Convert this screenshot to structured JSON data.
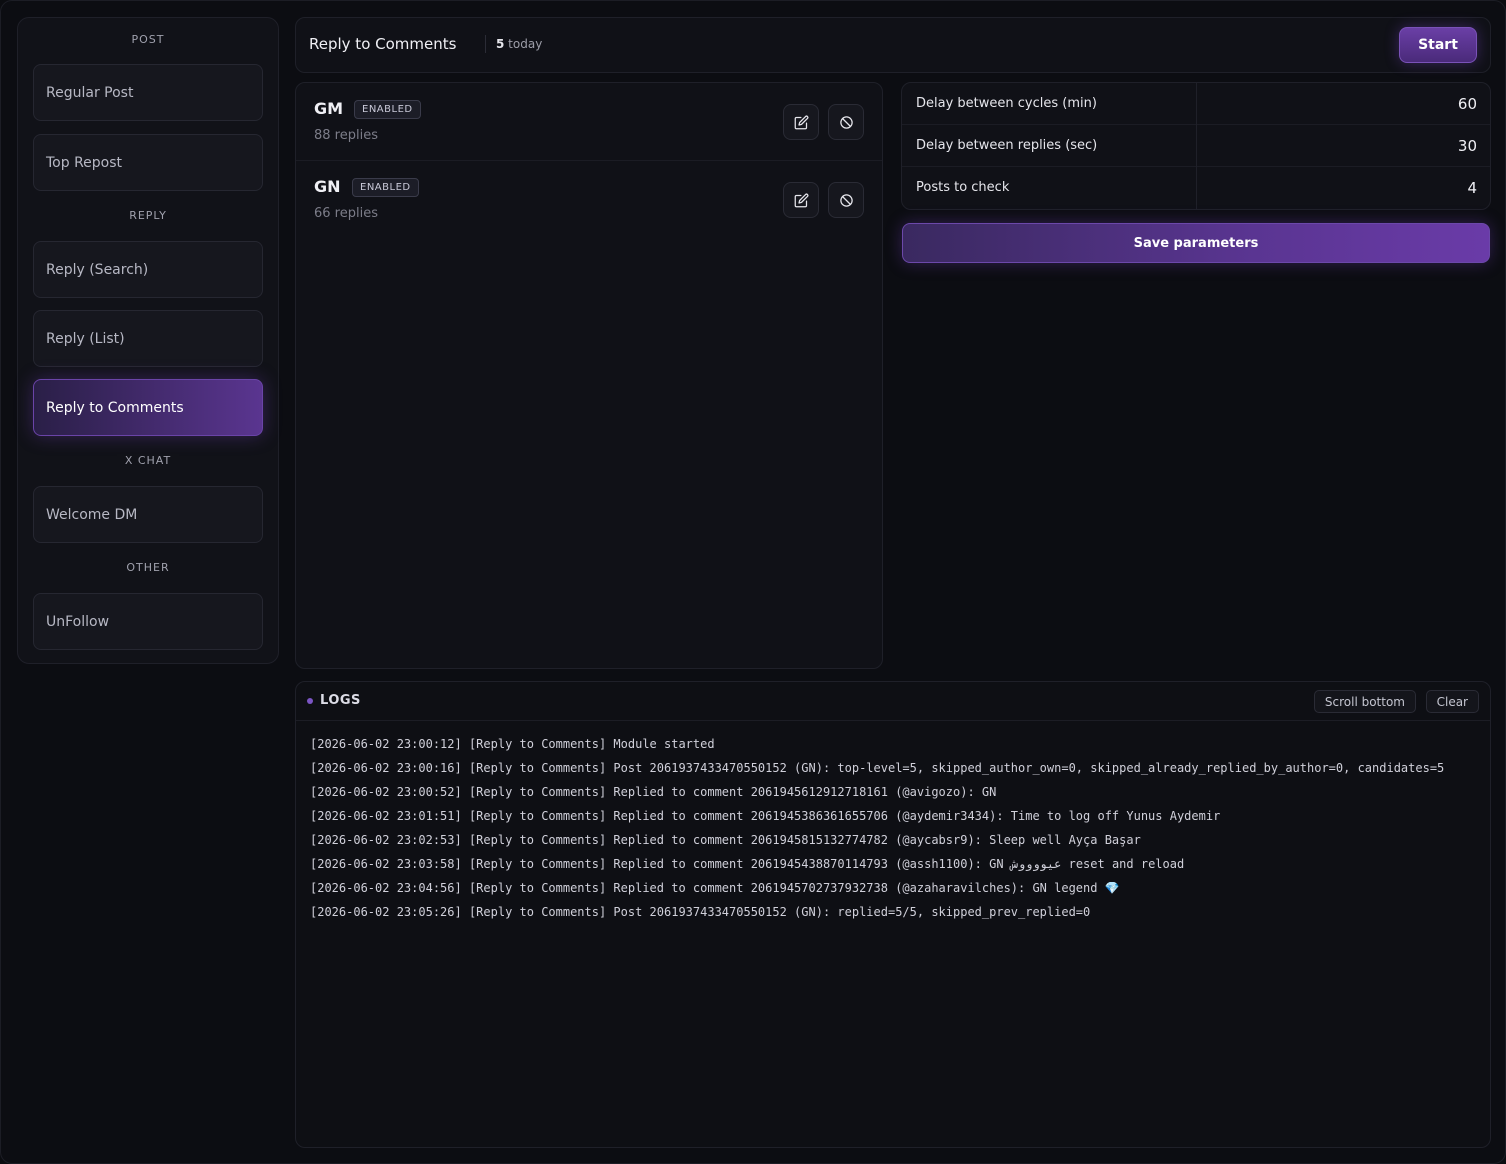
{
  "sidebar": {
    "sections": [
      {
        "label": "POST"
      },
      {
        "label": "REPLY"
      },
      {
        "label": "X CHAT"
      },
      {
        "label": "OTHER"
      }
    ],
    "items": [
      {
        "label": "Regular Post"
      },
      {
        "label": "Top Repost"
      },
      {
        "label": "Reply (Search)"
      },
      {
        "label": "Reply (List)"
      },
      {
        "label": "Reply to Comments",
        "active": true
      },
      {
        "label": "Welcome DM"
      },
      {
        "label": "UnFollow"
      }
    ]
  },
  "header": {
    "title": "Reply to Comments",
    "count_number": "5",
    "count_suffix": " today",
    "start_label": "Start"
  },
  "replies": [
    {
      "name": "GM",
      "status": "ENABLED",
      "sub": "88 replies",
      "edit_icon": "edit-icon",
      "disable_icon": "ban-icon"
    },
    {
      "name": "GN",
      "status": "ENABLED",
      "sub": "66 replies",
      "edit_icon": "edit-icon",
      "disable_icon": "ban-icon"
    }
  ],
  "params": [
    {
      "label": "Delay between cycles (min)",
      "value": "60"
    },
    {
      "label": "Delay between replies (sec)",
      "value": "30"
    },
    {
      "label": "Posts to check",
      "value": "4"
    }
  ],
  "save_label": "Save parameters",
  "logs": {
    "title": "LOGS",
    "scroll_label": "Scroll bottom",
    "clear_label": "Clear",
    "lines": [
      "[2026-06-02 23:00:12] [Reply to Comments] Module started",
      "[2026-06-02 23:00:16] [Reply to Comments] Post 2061937433470550152 (GN): top-level=5, skipped_author_own=0, skipped_already_replied_by_author=0, candidates=5",
      "[2026-06-02 23:00:52] [Reply to Comments] Replied to comment 2061945612912718161 (@avigozo): GN",
      "[2026-06-02 23:01:51] [Reply to Comments] Replied to comment 2061945386361655706 (@aydemir3434): Time to log off Yunus Aydemir",
      "[2026-06-02 23:02:53] [Reply to Comments] Replied to comment 2061945815132774782 (@aycabsr9): Sleep well Ayça Başar",
      "[2026-06-02 23:03:58] [Reply to Comments] Replied to comment 2061945438870114793 (@assh1100): GN عيووووش reset and reload",
      "[2026-06-02 23:04:56] [Reply to Comments] Replied to comment 2061945702737932738 (@azaharavilches): GN legend 💎",
      "[2026-06-02 23:05:26] [Reply to Comments] Post 2061937433470550152 (GN): replied=5/5, skipped_prev_replied=0"
    ]
  },
  "colors": {
    "accent": "#5a3590",
    "background": "#0c0d12"
  }
}
